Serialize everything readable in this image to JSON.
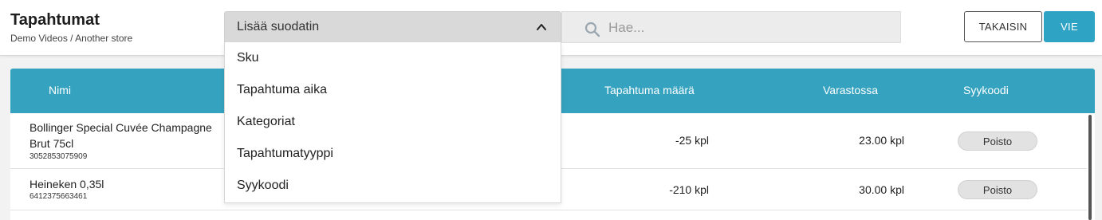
{
  "header": {
    "title": "Tapahtumat",
    "breadcrumb": "Demo Videos / Another store",
    "filter_label": "Lisää suodatin",
    "search_placeholder": "Hae...",
    "back_button": "TAKAISIN",
    "export_button": "VIE"
  },
  "filter_dropdown": {
    "options": [
      "Sku",
      "Tapahtuma aika",
      "Kategoriat",
      "Tapahtumatyyppi",
      "Syykoodi"
    ]
  },
  "table": {
    "columns": {
      "name": "Nimi",
      "amount": "Tapahtuma määrä",
      "stock": "Varastossa",
      "reason": "Syykoodi"
    },
    "rows": [
      {
        "name": "Bollinger Special Cuvée Champagne Brut 75cl",
        "sku": "3052853075909",
        "amount": "-25 kpl",
        "stock": "23.00 kpl",
        "reason": "Poisto"
      },
      {
        "name": "Heineken 0,35l",
        "sku": "6412375663461",
        "amount": "-210 kpl",
        "stock": "30.00 kpl",
        "reason": "Poisto"
      }
    ]
  },
  "colors": {
    "accent": "#2fa3c4",
    "table_header": "#35a2bf"
  },
  "icons": {
    "chevron": "chevron-up-icon",
    "search": "search-icon"
  }
}
